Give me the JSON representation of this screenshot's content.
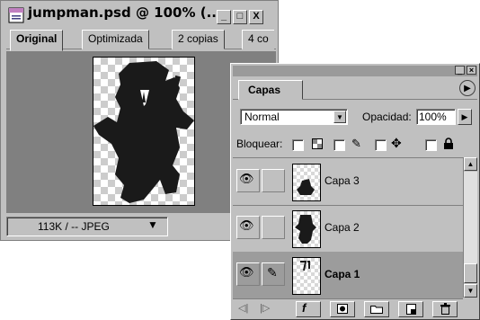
{
  "document": {
    "title": "jumpman.psd @ 100% (...",
    "buttons": {
      "minimize": "_",
      "maximize": "□",
      "close": "X"
    },
    "tabs": [
      {
        "label": "Original"
      },
      {
        "label": "Optimizada"
      },
      {
        "label": "2 copias"
      },
      {
        "label": "4 co"
      }
    ],
    "status": "113K / -- JPEG"
  },
  "layers_panel": {
    "tab": "Capas",
    "blend_mode": "Normal",
    "opacity_label": "Opacidad:",
    "opacity_value": "100%",
    "lock_label": "Bloquear:",
    "layers": [
      {
        "name": "Capa 3"
      },
      {
        "name": "Capa 2"
      },
      {
        "name": "Capa 1",
        "selected": true
      }
    ]
  }
}
